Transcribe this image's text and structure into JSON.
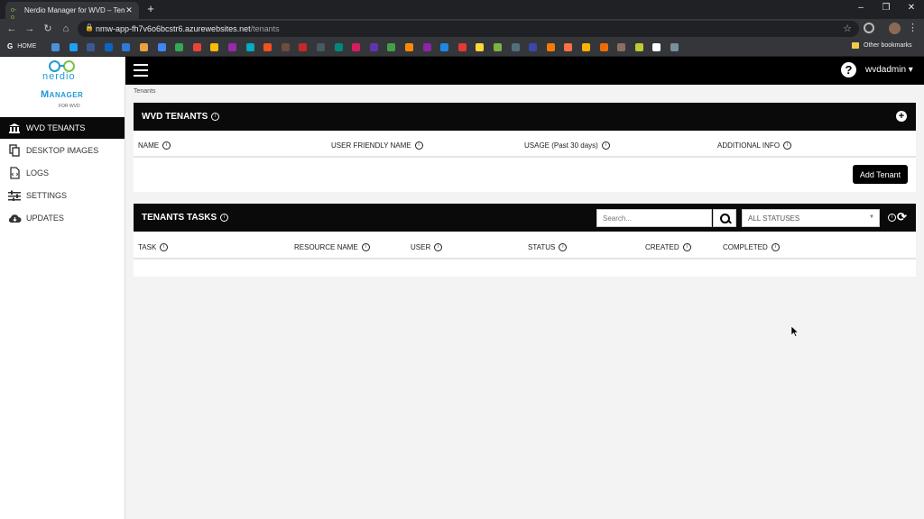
{
  "browser": {
    "tab_title": "Nerdio Manager for WVD – Tenants",
    "url_domain": "nmw-app-fh7v6o6bcstr6.azurewebsites.net",
    "url_path": "/tenants",
    "bookmark_home": "HOME",
    "other_bookmarks": "Other bookmarks"
  },
  "logo": {
    "word": "nerdio",
    "manager": "Manager",
    "for": "FOR WVD"
  },
  "sidebar": {
    "items": [
      {
        "label": "WVD TENANTS",
        "icon": "bank-icon"
      },
      {
        "label": "DESKTOP IMAGES",
        "icon": "copy-icon"
      },
      {
        "label": "LOGS",
        "icon": "code-file-icon"
      },
      {
        "label": "SETTINGS",
        "icon": "sliders-icon"
      },
      {
        "label": "UPDATES",
        "icon": "cloud-download-icon"
      }
    ]
  },
  "header": {
    "user": "wvdadmin"
  },
  "breadcrumb": "Tenants",
  "tenants_panel": {
    "title": "WVD TENANTS",
    "columns": [
      "NAME",
      "USER FRIENDLY NAME",
      "USAGE (Past 30 days)",
      "ADDITIONAL INFO"
    ],
    "add_button": "Add Tenant"
  },
  "tasks_panel": {
    "title": "TENANTS TASKS",
    "search_placeholder": "Search...",
    "status_filter": "ALL STATUSES",
    "columns": [
      "TASK",
      "RESOURCE NAME",
      "USER",
      "STATUS",
      "CREATED",
      "COMPLETED"
    ]
  },
  "colors": {
    "accent": "#1f9ad6",
    "accent_green": "#7cc242",
    "dark": "#0a0a0a"
  }
}
